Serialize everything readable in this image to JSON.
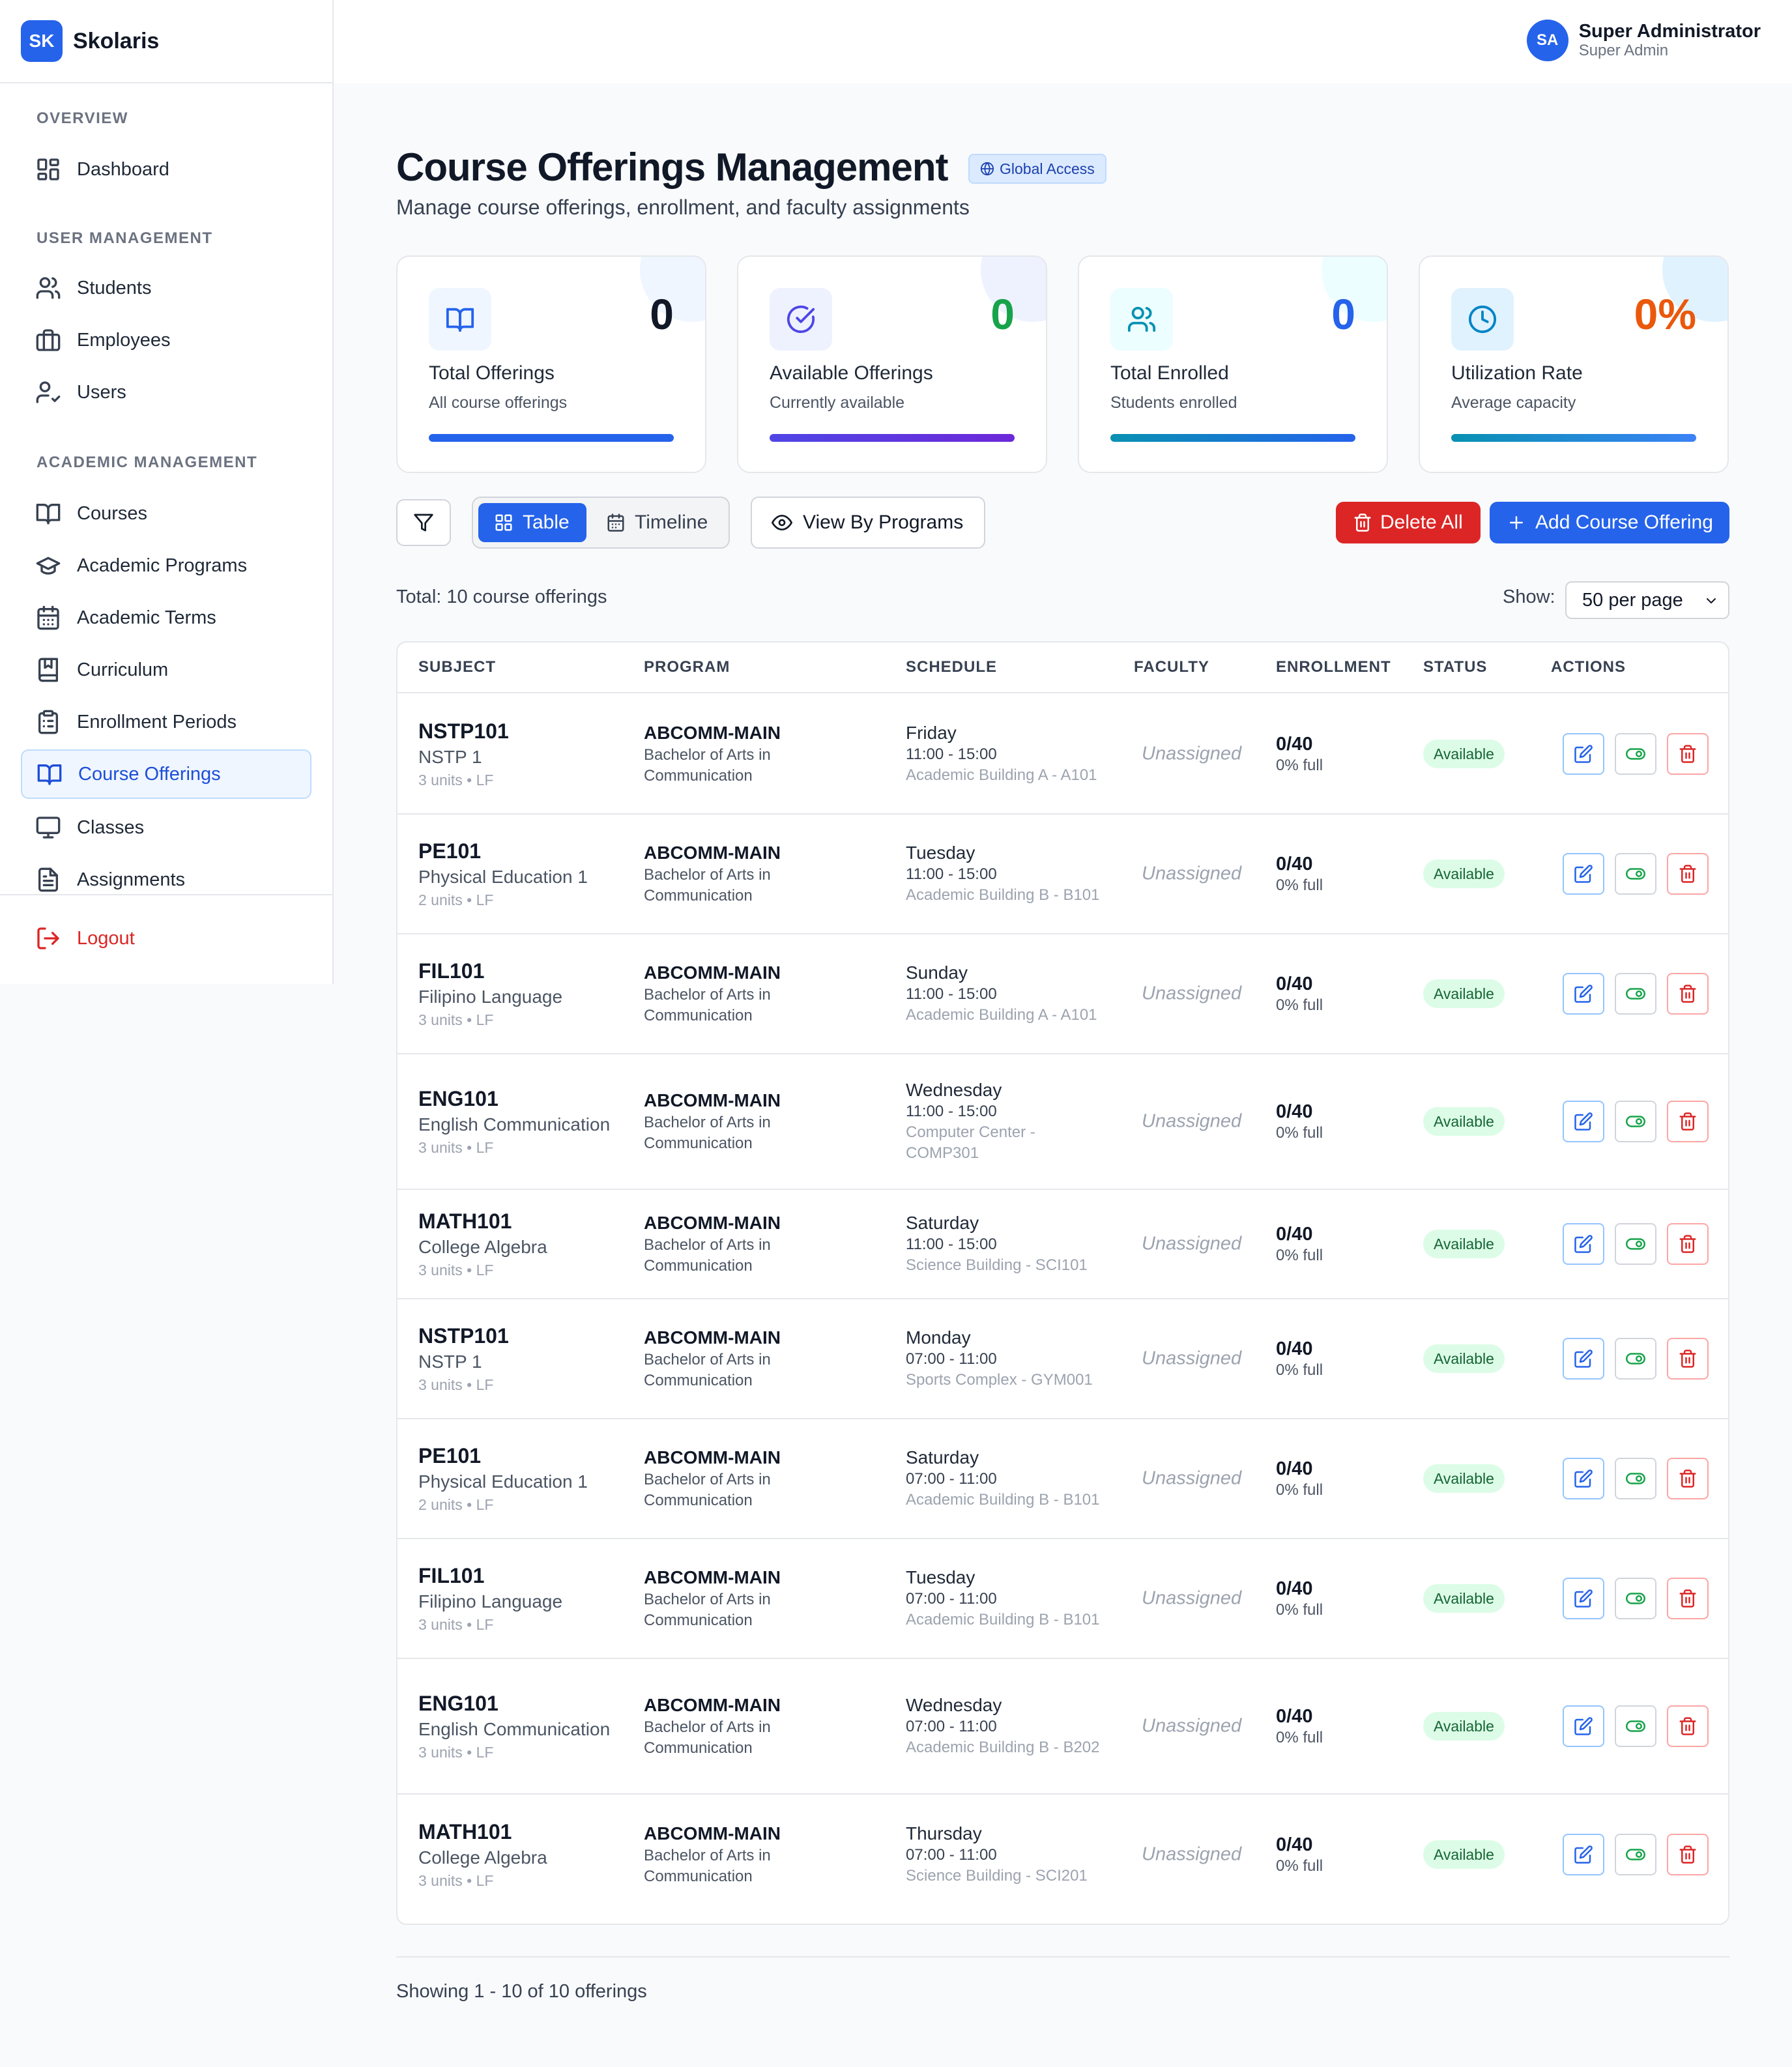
{
  "brand": {
    "logo": "SK",
    "name": "Skolaris"
  },
  "user": {
    "initials": "SA",
    "name": "Super Administrator",
    "role": "Super Admin"
  },
  "sidebar": {
    "sections": {
      "overview": "OVERVIEW",
      "user_management": "USER MANAGEMENT",
      "academic_management": "ACADEMIC MANAGEMENT"
    },
    "items": {
      "dashboard": {
        "label": "Dashboard",
        "icon": "dashboard-icon"
      },
      "students": {
        "label": "Students",
        "icon": "students-icon"
      },
      "employees": {
        "label": "Employees",
        "icon": "briefcase-icon"
      },
      "users": {
        "label": "Users",
        "icon": "user-check-icon"
      },
      "courses": {
        "label": "Courses",
        "icon": "book-icon"
      },
      "programs": {
        "label": "Academic Programs",
        "icon": "graduation-cap-icon"
      },
      "terms": {
        "label": "Academic Terms",
        "icon": "calendar-icon"
      },
      "curriculum": {
        "label": "Curriculum",
        "icon": "bookmark-book-icon"
      },
      "enrollment": {
        "label": "Enrollment Periods",
        "icon": "clipboard-icon"
      },
      "offerings": {
        "label": "Course Offerings",
        "icon": "book-open-icon",
        "active": true
      },
      "classes": {
        "label": "Classes",
        "icon": "monitor-icon"
      },
      "assignments": {
        "label": "Assignments",
        "icon": "file-text-icon"
      }
    },
    "logout": "Logout"
  },
  "page": {
    "title": "Course Offerings Management",
    "badge": "Global Access",
    "subtitle": "Manage course offerings, enrollment, and faculty assignments"
  },
  "stats": [
    {
      "label": "Total Offerings",
      "sub": "All course offerings",
      "value": "0",
      "color": "#111827",
      "icon": "book-open-icon"
    },
    {
      "label": "Available Offerings",
      "sub": "Currently available",
      "value": "0",
      "color": "#16a34a",
      "icon": "check-circle-icon"
    },
    {
      "label": "Total Enrolled",
      "sub": "Students enrolled",
      "value": "0",
      "color": "#2563eb",
      "icon": "users-icon"
    },
    {
      "label": "Utilization Rate",
      "sub": "Average capacity",
      "value": "0%",
      "color": "#ea580c",
      "icon": "clock-icon"
    }
  ],
  "toolbar": {
    "table": "Table",
    "timeline": "Timeline",
    "view_by_programs": "View By Programs",
    "delete_all": "Delete All",
    "add": "Add Course Offering"
  },
  "summary": {
    "total": "Total: 10 course offerings",
    "show_label": "Show:",
    "per_page": "50 per page",
    "showing": "Showing 1 - 10 of 10 offerings"
  },
  "table": {
    "headers": [
      "SUBJECT",
      "PROGRAM",
      "SCHEDULE",
      "FACULTY",
      "ENROLLMENT",
      "STATUS",
      "ACTIONS"
    ],
    "rows": [
      {
        "code": "NSTP101",
        "name": "NSTP 1",
        "units": "3 units • LF",
        "program": "ABCOMM-MAIN",
        "program_name": "Bachelor of Arts in Communication",
        "day": "Friday",
        "time": "11:00 - 15:00",
        "room": "Academic Building A - A101",
        "faculty": "Unassigned",
        "enrolled": "0/40",
        "pct": "0% full",
        "status": "Available"
      },
      {
        "code": "PE101",
        "name": "Physical Education 1",
        "units": "2 units • LF",
        "program": "ABCOMM-MAIN",
        "program_name": "Bachelor of Arts in Communication",
        "day": "Tuesday",
        "time": "11:00 - 15:00",
        "room": "Academic Building B - B101",
        "faculty": "Unassigned",
        "enrolled": "0/40",
        "pct": "0% full",
        "status": "Available"
      },
      {
        "code": "FIL101",
        "name": "Filipino Language",
        "units": "3 units • LF",
        "program": "ABCOMM-MAIN",
        "program_name": "Bachelor of Arts in Communication",
        "day": "Sunday",
        "time": "11:00 - 15:00",
        "room": "Academic Building A - A101",
        "faculty": "Unassigned",
        "enrolled": "0/40",
        "pct": "0% full",
        "status": "Available"
      },
      {
        "code": "ENG101",
        "name": "English Communication",
        "units": "3 units • LF",
        "program": "ABCOMM-MAIN",
        "program_name": "Bachelor of Arts in Communication",
        "day": "Wednesday",
        "time": "11:00 - 15:00",
        "room": "Computer Center - COMP301",
        "faculty": "Unassigned",
        "enrolled": "0/40",
        "pct": "0% full",
        "status": "Available"
      },
      {
        "code": "MATH101",
        "name": "College Algebra",
        "units": "3 units • LF",
        "program": "ABCOMM-MAIN",
        "program_name": "Bachelor of Arts in Communication",
        "day": "Saturday",
        "time": "11:00 - 15:00",
        "room": "Science Building - SCI101",
        "faculty": "Unassigned",
        "enrolled": "0/40",
        "pct": "0% full",
        "status": "Available"
      },
      {
        "code": "NSTP101",
        "name": "NSTP 1",
        "units": "3 units • LF",
        "program": "ABCOMM-MAIN",
        "program_name": "Bachelor of Arts in Communication",
        "day": "Monday",
        "time": "07:00 - 11:00",
        "room": "Sports Complex - GYM001",
        "faculty": "Unassigned",
        "enrolled": "0/40",
        "pct": "0% full",
        "status": "Available"
      },
      {
        "code": "PE101",
        "name": "Physical Education 1",
        "units": "2 units • LF",
        "program": "ABCOMM-MAIN",
        "program_name": "Bachelor of Arts in Communication",
        "day": "Saturday",
        "time": "07:00 - 11:00",
        "room": "Academic Building B - B101",
        "faculty": "Unassigned",
        "enrolled": "0/40",
        "pct": "0% full",
        "status": "Available"
      },
      {
        "code": "FIL101",
        "name": "Filipino Language",
        "units": "3 units • LF",
        "program": "ABCOMM-MAIN",
        "program_name": "Bachelor of Arts in Communication",
        "day": "Tuesday",
        "time": "07:00 - 11:00",
        "room": "Academic Building B - B101",
        "faculty": "Unassigned",
        "enrolled": "0/40",
        "pct": "0% full",
        "status": "Available"
      },
      {
        "code": "ENG101",
        "name": "English Communication",
        "units": "3 units • LF",
        "program": "ABCOMM-MAIN",
        "program_name": "Bachelor of Arts in Communication",
        "day": "Wednesday",
        "time": "07:00 - 11:00",
        "room": "Academic Building B - B202",
        "faculty": "Unassigned",
        "enrolled": "0/40",
        "pct": "0% full",
        "status": "Available"
      },
      {
        "code": "MATH101",
        "name": "College Algebra",
        "units": "3 units • LF",
        "program": "ABCOMM-MAIN",
        "program_name": "Bachelor of Arts in Communication",
        "day": "Thursday",
        "time": "07:00 - 11:00",
        "room": "Science Building - SCI201",
        "faculty": "Unassigned",
        "enrolled": "0/40",
        "pct": "0% full",
        "status": "Available"
      }
    ]
  }
}
